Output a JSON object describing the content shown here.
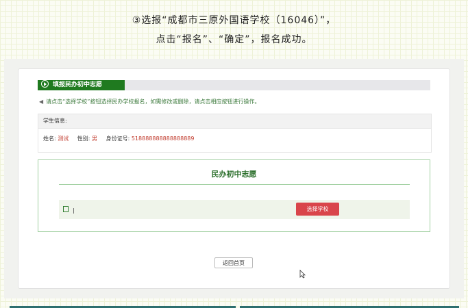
{
  "instructions": {
    "line1": "③选报“成都市三原外国语学校（16046）”，",
    "line2": "点击“报名”、“确定”，报名成功。"
  },
  "header": {
    "title": "填报民办初中志愿"
  },
  "notice": {
    "text": "请点击“选择学校”按钮选择民办学校报名，如需修改或删除，请点击相应按钮进行操作。"
  },
  "student_info": {
    "heading": "学生信息:",
    "name_label": "姓名:",
    "name_value": "测试",
    "gender_label": "性别:",
    "gender_value": "男",
    "id_label": "身份证号:",
    "id_value": "518888888888888889"
  },
  "volunteer": {
    "title": "民办初中志愿",
    "row_text": "|",
    "select_button": "选择学校"
  },
  "footer": {
    "back_button": "返回首页"
  },
  "colors": {
    "header_green": "#1f7a1f",
    "select_red": "#d9454b",
    "value_red": "#c0392b",
    "notice_green": "#3c7a3c"
  }
}
